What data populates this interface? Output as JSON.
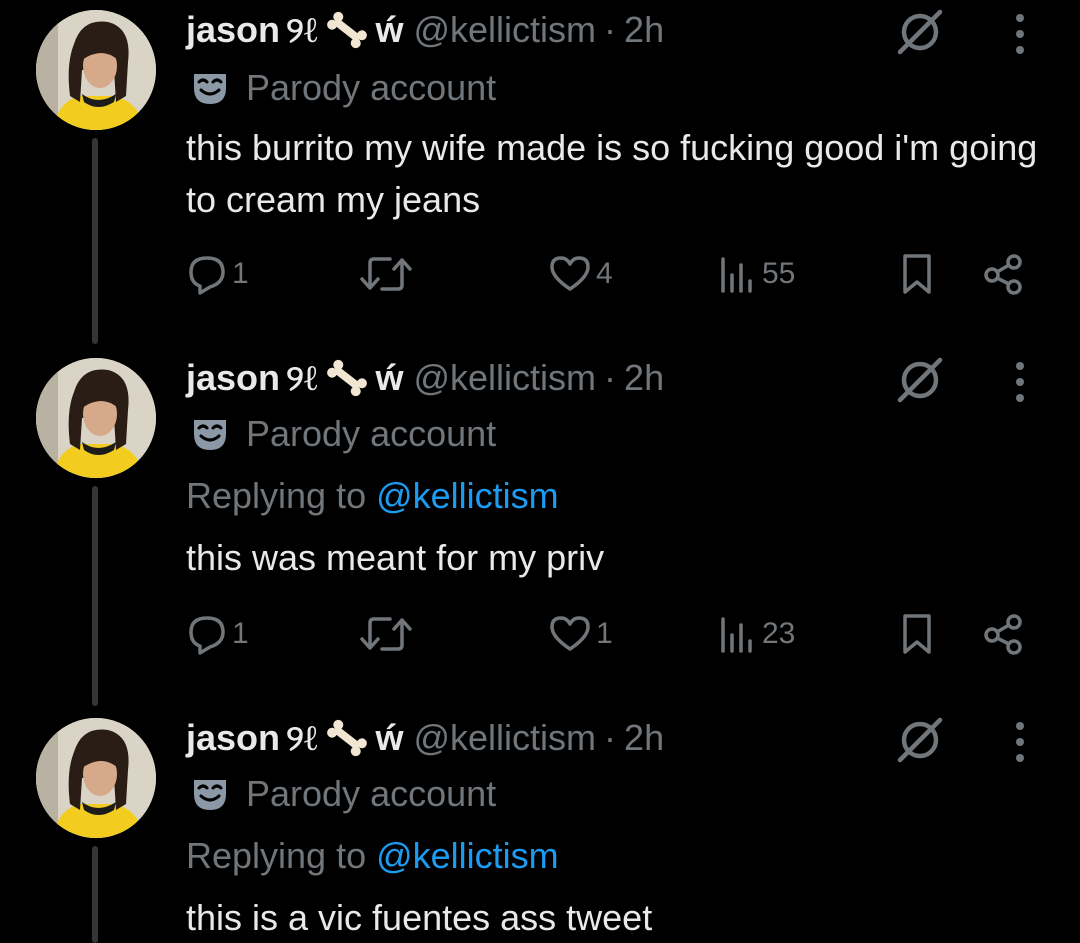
{
  "tweets": [
    {
      "display_name": "jason",
      "name_glyph_a": "୨ℓ",
      "name_glyph_b": "ẃ",
      "handle": "@kellictism",
      "separator": "·",
      "time": "2h",
      "parody_label": "Parody account",
      "replying_prefix": "",
      "replying_handle": "",
      "text": "this burrito my wife made is so fucking good i'm going to cream my jeans",
      "replies": "1",
      "retweets": "",
      "likes": "4",
      "views": "55"
    },
    {
      "display_name": "jason",
      "name_glyph_a": "୨ℓ",
      "name_glyph_b": "ẃ",
      "handle": "@kellictism",
      "separator": "·",
      "time": "2h",
      "parody_label": "Parody account",
      "replying_prefix": "Replying to ",
      "replying_handle": "@kellictism",
      "text": "this was meant for my priv",
      "replies": "1",
      "retweets": "",
      "likes": "1",
      "views": "23"
    },
    {
      "display_name": "jason",
      "name_glyph_a": "୨ℓ",
      "name_glyph_b": "ẃ",
      "handle": "@kellictism",
      "separator": "·",
      "time": "2h",
      "parody_label": "Parody account",
      "replying_prefix": "Replying to ",
      "replying_handle": "@kellictism",
      "text": "this is a vic fuentes ass tweet"
    }
  ],
  "icons": {
    "reply": "reply-icon",
    "retweet": "retweet-icon",
    "like": "heart-icon",
    "views": "views-icon",
    "bookmark": "bookmark-icon",
    "share": "share-icon",
    "grok": "grok-icon",
    "more": "more-icon",
    "parody": "theater-mask-icon",
    "bone": "bone-icon"
  },
  "colors": {
    "background": "#000000",
    "text": "#e7e9ea",
    "secondary": "#71767b",
    "link": "#1d9bf0",
    "thread_line": "#333639",
    "avatar_shirt": "#f2cc1f"
  }
}
